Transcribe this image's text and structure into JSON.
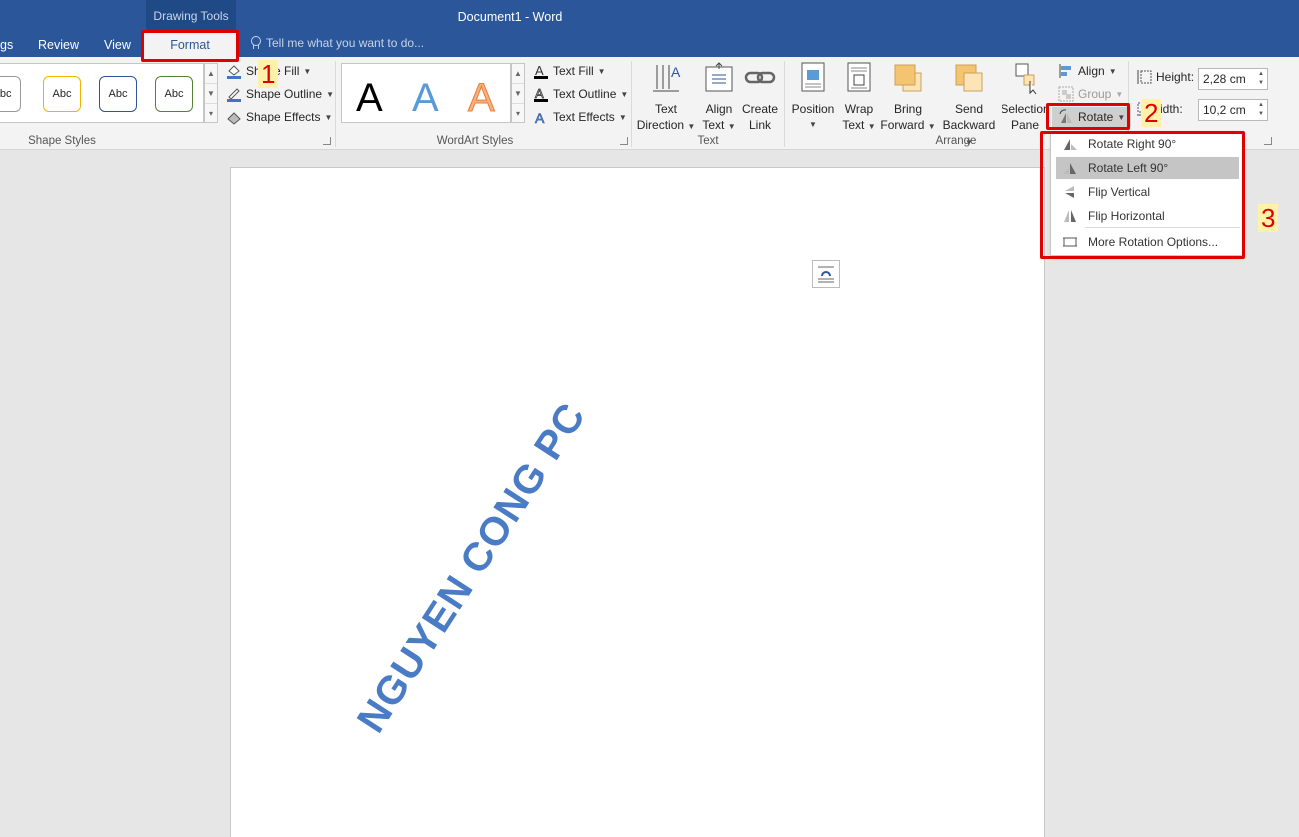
{
  "titlebar": {
    "context_group": "Drawing Tools",
    "window_title": "Document1 - Word",
    "tabs": [
      {
        "label": "gs"
      },
      {
        "label": "Review"
      },
      {
        "label": "View"
      },
      {
        "label": "Format"
      }
    ],
    "tell_me_placeholder": "Tell me what you want to do..."
  },
  "ribbon": {
    "shape_styles": {
      "label": "Shape Styles",
      "thumbs": [
        "Abc",
        "Abc",
        "Abc",
        "Abc"
      ],
      "thumb_colors": [
        "#999999",
        "#f0b400",
        "#2f5597",
        "#548235"
      ],
      "shape_fill": "Shape Fill",
      "shape_outline": "Shape Outline",
      "shape_effects": "Shape Effects"
    },
    "wordart_styles": {
      "label": "WordArt Styles",
      "letters": [
        "A",
        "A",
        "A"
      ],
      "letter_colors": [
        "#000000",
        "#5b9bd5",
        "#f4b183"
      ],
      "text_fill": "Text Fill",
      "text_outline": "Text Outline",
      "text_effects": "Text Effects"
    },
    "text": {
      "label": "Text",
      "text_direction": [
        "Text",
        "Direction"
      ],
      "align_text": [
        "Align",
        "Text"
      ],
      "create_link": [
        "Create",
        "Link"
      ]
    },
    "arrange": {
      "label": "Arrange",
      "position": "Position",
      "wrap_text": [
        "Wrap",
        "Text"
      ],
      "bring_forward": [
        "Bring",
        "Forward"
      ],
      "send_backward": [
        "Send",
        "Backward"
      ],
      "selection_pane": [
        "Selection",
        "Pane"
      ],
      "align": "Align",
      "group": "Group",
      "rotate": "Rotate"
    },
    "size": {
      "height_label": "Height:",
      "height_value": "2,28 cm",
      "width_label": "idth:",
      "width_value": "10,2 cm"
    }
  },
  "rotate_menu": {
    "items": [
      {
        "label": "Rotate Right 90°"
      },
      {
        "label": "Rotate Left 90°"
      },
      {
        "label": "Flip Vertical"
      },
      {
        "label": "Flip Horizontal"
      },
      {
        "label": "More Rotation Options..."
      }
    ]
  },
  "document": {
    "wordart_text": "NGUYEN CONG PC"
  },
  "annotations": {
    "markers": [
      "1",
      "2",
      "3"
    ],
    "color": "#e00000"
  }
}
